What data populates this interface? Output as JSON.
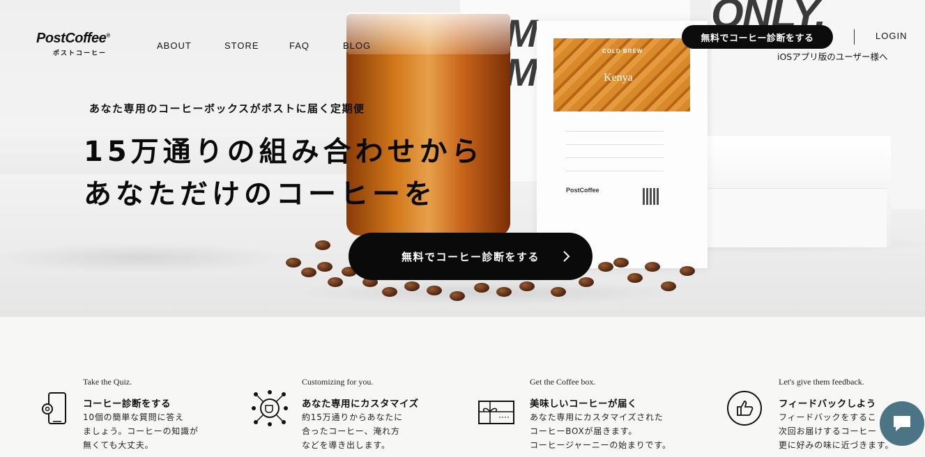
{
  "header": {
    "logo_main": "PostCoffee",
    "logo_reg": "®",
    "logo_sub": "ポストコーヒー",
    "nav": [
      "ABOUT",
      "STORE",
      "FAQ",
      "BLOG"
    ],
    "cta_label": "無料でコーヒー診断をする",
    "login_label": "LOGIN",
    "ios_label": "iOSアプリ版のユーザー様へ"
  },
  "hero": {
    "tagline": "あなた専用のコーヒーボックスがポストに届く定期便",
    "headline_line1": "15万通りの組み合わせから",
    "headline_line2": "あなただけのコーヒーを",
    "cta_label": "無料でコーヒー診断をする",
    "bag_brand": "COLD BREW",
    "bag_origin": "Kenya",
    "bag_logo": "PostCoffee"
  },
  "steps": [
    {
      "en": "Take the Quiz.",
      "title": "コーヒー診断をする",
      "desc": "10個の簡単な質問に答え\nましょう。コーヒーの知識が\n無くても大丈夫。",
      "icon": "phone-gear-icon"
    },
    {
      "en": "Customizing for you.",
      "title": "あなた専用にカスタマイズ",
      "desc": "約15万通りからあなたに\n合ったコーヒー、淹れ方\nなどを導き出します。",
      "icon": "cup-network-icon"
    },
    {
      "en": "Get the Coffee box.",
      "title": "美味しいコーヒーが届く",
      "desc": "あなた専用にカスタマイズされた\nコーヒーBOXが届きます。\nコーヒージャーニーの始まりです。",
      "icon": "gift-box-icon"
    },
    {
      "en": "Let's give them feedback.",
      "title": "フィードバックしよう",
      "desc": "フィードバックをするこ\n次回お届けするコーヒー\n更に好みの味に近づきます。",
      "icon": "thumbs-up-icon"
    }
  ],
  "chat": {
    "icon": "chat-bubble-icon",
    "color": "#4b7585"
  }
}
